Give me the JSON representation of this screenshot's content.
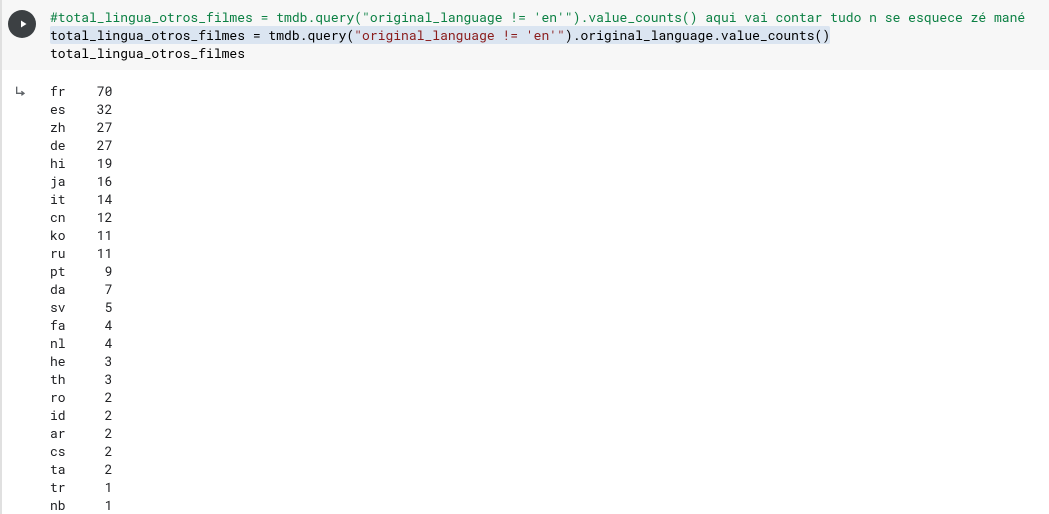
{
  "code": {
    "comment_prefix": "#total_lingua_otros_filmes",
    "comment_eq": " = ",
    "comment_call1": "tmdb.query(",
    "comment_str": "\"original_language != 'en'\"",
    "comment_call2": ").value_counts()",
    "comment_tail": " aqui vai contar tudo n se esquece zé mané",
    "line2_a": "total_lingua_otros_filmes = tmdb.query(",
    "line2_str": "\"original_language != 'en'\"",
    "line2_b": ").original_language.value_counts()",
    "line3": "total_lingua_otros_filmes"
  },
  "output_rows": [
    {
      "lang": "fr",
      "count": "70"
    },
    {
      "lang": "es",
      "count": "32"
    },
    {
      "lang": "zh",
      "count": "27"
    },
    {
      "lang": "de",
      "count": "27"
    },
    {
      "lang": "hi",
      "count": "19"
    },
    {
      "lang": "ja",
      "count": "16"
    },
    {
      "lang": "it",
      "count": "14"
    },
    {
      "lang": "cn",
      "count": "12"
    },
    {
      "lang": "ko",
      "count": "11"
    },
    {
      "lang": "ru",
      "count": "11"
    },
    {
      "lang": "pt",
      "count": "9"
    },
    {
      "lang": "da",
      "count": "7"
    },
    {
      "lang": "sv",
      "count": "5"
    },
    {
      "lang": "fa",
      "count": "4"
    },
    {
      "lang": "nl",
      "count": "4"
    },
    {
      "lang": "he",
      "count": "3"
    },
    {
      "lang": "th",
      "count": "3"
    },
    {
      "lang": "ro",
      "count": "2"
    },
    {
      "lang": "id",
      "count": "2"
    },
    {
      "lang": "ar",
      "count": "2"
    },
    {
      "lang": "cs",
      "count": "2"
    },
    {
      "lang": "ta",
      "count": "2"
    },
    {
      "lang": "tr",
      "count": "1"
    },
    {
      "lang": "nb",
      "count": "1"
    }
  ]
}
